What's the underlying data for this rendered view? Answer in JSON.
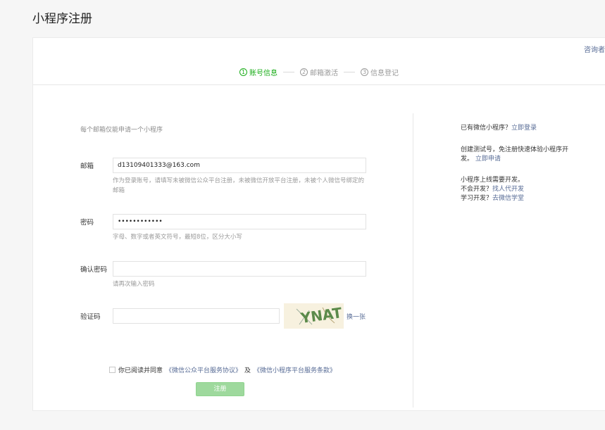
{
  "page": {
    "title": "小程序注册"
  },
  "header": {
    "consult_text": "咨询者",
    "steps": [
      {
        "num": "1",
        "label": "账号信息"
      },
      {
        "num": "2",
        "label": "邮箱激活"
      },
      {
        "num": "3",
        "label": "信息登记"
      }
    ]
  },
  "form": {
    "notice": "每个邮箱仅能申请一个小程序",
    "email": {
      "label": "邮箱",
      "value": "d13109401333@163.com",
      "tip": "作为登录账号，请填写未被微信公众平台注册，未被微信开放平台注册，未被个人微信号绑定的邮箱"
    },
    "password": {
      "label": "密码",
      "value": "••••••••••••",
      "tip": "字母、数字或者英文符号，最短8位，区分大小写"
    },
    "confirm": {
      "label": "确认密码",
      "value": "",
      "tip": "请再次输入密码"
    },
    "captcha": {
      "label": "验证码",
      "value": "",
      "image_text": "YNAT",
      "swap_label": "换一张"
    },
    "agreement": {
      "prefix": "你已阅读并同意",
      "link1": "《微信公众平台服务协议》",
      "middle": "及",
      "link2": "《微信小程序平台服务条款》"
    },
    "submit_label": "注册"
  },
  "sidebar": {
    "login_prompt": "已有微信小程序？",
    "login_link": "立即登录",
    "test_text": "创建测试号，免注册快速体验小程序开发。",
    "test_link": "立即申请",
    "dev_line": "小程序上线需要开发。",
    "no_dev_prompt": "不会开发？",
    "no_dev_link": "找人代开发",
    "learn_prompt": "学习开发？",
    "learn_link": "去微信学堂"
  },
  "colors": {
    "accent": "#1aad19",
    "link": "#576b95",
    "button_disabled": "#9ed99d"
  }
}
